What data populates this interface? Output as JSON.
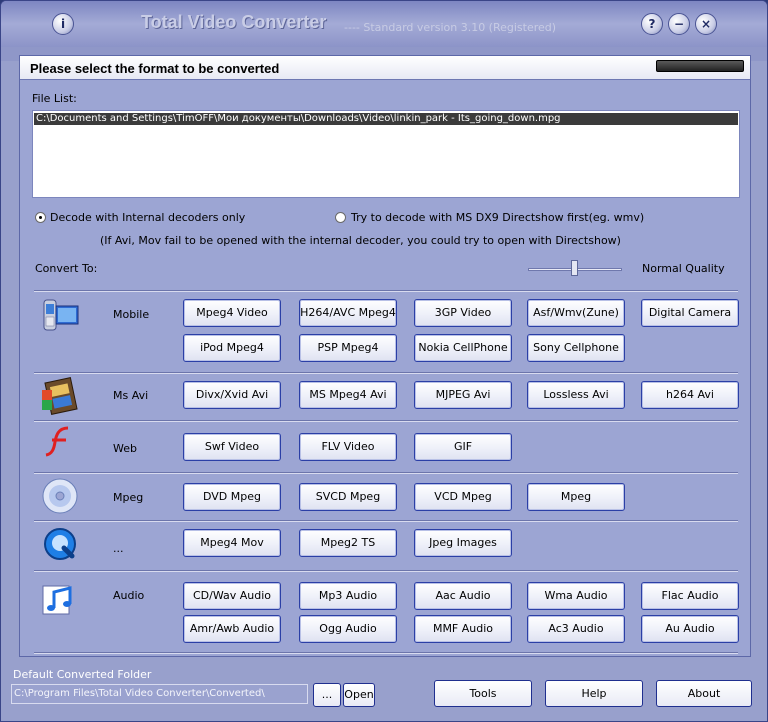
{
  "window": {
    "title": "Total Video Converter",
    "version": "---- Standard version 3.10 (Registered)",
    "info_glyph": "i",
    "help_glyph": "?",
    "minimize_glyph": "−",
    "close_glyph": "×"
  },
  "panel": {
    "header": "Please select the format to be converted",
    "file_list_label": "File List:",
    "files": [
      "C:\\Documents and Settings\\TimOFF\\Мои документы\\Downloads\\Video\\linkin_park - Its_going_down.mpg"
    ],
    "decode_internal": "Decode with Internal decoders only",
    "decode_directshow": "Try to decode with MS DX9 Directshow first(eg. wmv)",
    "decode_hint": "(If Avi, Mov fail to be opened with the internal decoder, you could try to open with Directshow)",
    "convert_to_label": "Convert To:",
    "quality_label": "Normal Quality",
    "quality_level": 0.5
  },
  "categories": [
    {
      "label": "Mobile",
      "icon": "mobile-video-icon",
      "buttons": [
        "Mpeg4 Video",
        "H264/AVC Mpeg4",
        "3GP Video",
        "Asf/Wmv(Zune)",
        "Digital Camera",
        "iPod Mpeg4",
        "PSP Mpeg4",
        "Nokia CellPhone",
        "Sony Cellphone"
      ]
    },
    {
      "label": "Ms Avi",
      "icon": "avi-film-icon",
      "buttons": [
        "Divx/Xvid Avi",
        "MS Mpeg4 Avi",
        "MJPEG Avi",
        "Lossless Avi",
        "h264 Avi"
      ]
    },
    {
      "label": "Web",
      "icon": "flash-icon",
      "buttons": [
        "Swf Video",
        "FLV Video",
        "GIF"
      ]
    },
    {
      "label": "Mpeg",
      "icon": "disc-icon",
      "buttons": [
        "DVD Mpeg",
        "SVCD Mpeg",
        "VCD Mpeg",
        "Mpeg"
      ]
    },
    {
      "label": "...",
      "icon": "quicktime-icon",
      "buttons": [
        "Mpeg4 Mov",
        "Mpeg2 TS",
        "Jpeg Images"
      ]
    },
    {
      "label": "Audio",
      "icon": "music-note-icon",
      "buttons": [
        "CD/Wav Audio",
        "Mp3 Audio",
        "Aac Audio",
        "Wma Audio",
        "Flac Audio",
        "Amr/Awb Audio",
        "Ogg Audio",
        "MMF Audio",
        "Ac3 Audio",
        "Au Audio"
      ]
    }
  ],
  "bottom": {
    "folder_label": "Default Converted Folder",
    "folder_path": "C:\\Program Files\\Total Video Converter\\Converted\\",
    "browse_label": "...",
    "open_label": "Open",
    "tools_label": "Tools",
    "help_label": "Help",
    "about_label": "About"
  }
}
